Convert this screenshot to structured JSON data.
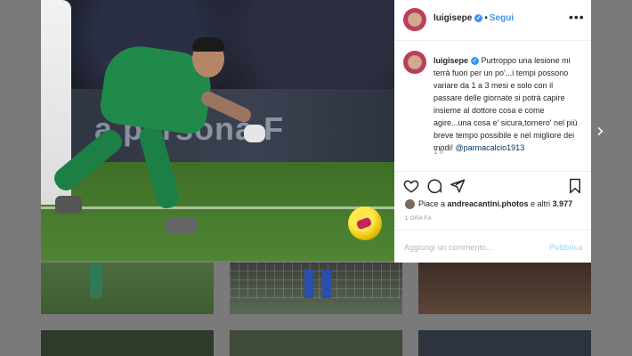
{
  "header": {
    "username": "luigisepe",
    "separator": "•",
    "follow_label": "Segui",
    "more_icon": "more-icon"
  },
  "photo": {
    "ad_text": "a persona F"
  },
  "comment": {
    "username": "luigisepe",
    "text": "Purtroppo una lesione mi terrà fuori per un po'...i tempi possono variare da 1 a 3 mesi e solo con il passare delle giornate si potrà capire insieme al dottore cosa e come agire...una cosa e' sicura,tornero' nel più breve tempo possibile e nel migliore dei modi! ",
    "mention": "@parmacalcio1913",
    "time": "1 h"
  },
  "likes": {
    "prefix": "Piace a ",
    "user": "andreacantini.photos",
    "middle": " e altri ",
    "count": "3.977"
  },
  "post_time": "1 ORA FA",
  "add_comment": {
    "placeholder": "Aggiungi un commento...",
    "publish_label": "Pubblica"
  },
  "nav": {
    "next_glyph": "›"
  },
  "colors": {
    "accent": "#3897f0",
    "publish_disabled": "#b2dffc"
  }
}
